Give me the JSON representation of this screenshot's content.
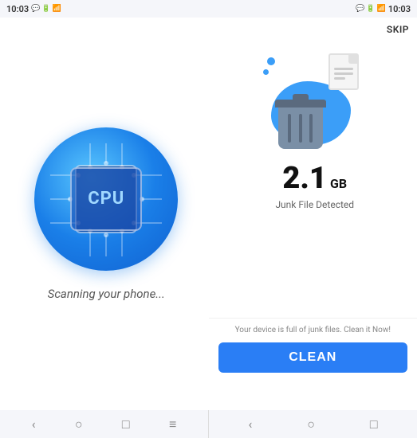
{
  "statusBar": {
    "left": {
      "time": "10:03"
    },
    "right": {
      "time": "10:03"
    }
  },
  "skipButton": {
    "label": "SKIP"
  },
  "leftPanel": {
    "scanningText": "Scanning your phone...",
    "cpuLabel": "CPU"
  },
  "rightPanel": {
    "junkSize": "2.1",
    "junkUnit": "GB",
    "junkDetectedText": "Junk File Detected"
  },
  "bottomAction": {
    "warningText": "Your device is full of junk files. Clean it Now!",
    "cleanButtonLabel": "CLEAN"
  },
  "nav": {
    "back": "‹",
    "home": "○",
    "recents": "□",
    "menu": "≡"
  }
}
